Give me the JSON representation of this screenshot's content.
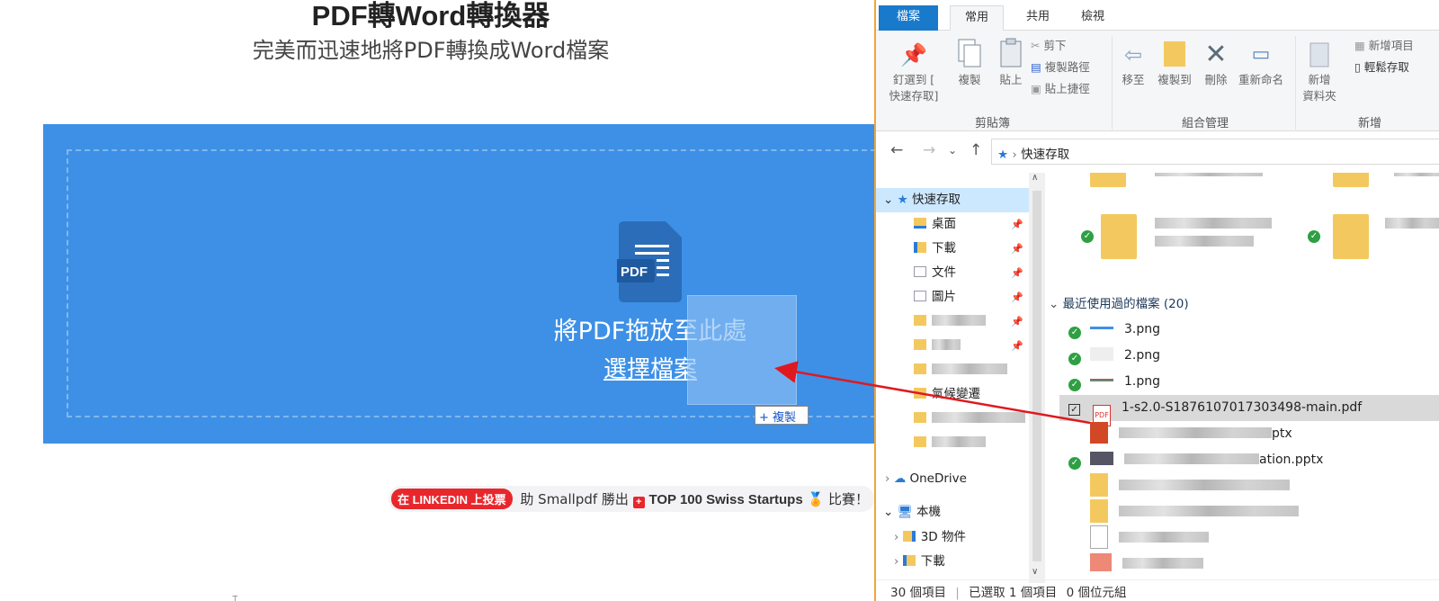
{
  "page": {
    "title": "PDF轉Word轉換器",
    "subtitle": "完美而迅速地將PDF轉換成Word檔案"
  },
  "dropzone": {
    "icon_label": "PDF",
    "drop_text": "將PDF拖放至此處",
    "choose_file": "選擇檔案",
    "copy_tip": "+ 複製",
    "bg": "#3d90e6"
  },
  "banner": {
    "vote": "在 LINKEDIN 上投票",
    "text1": "助 Smallpdf 勝出",
    "highlight": "TOP 100 Swiss Startups",
    "text2": "比賽！"
  },
  "explorer": {
    "tabs": {
      "file": "檔案",
      "home": "常用",
      "share": "共用",
      "view": "檢視"
    },
    "ribbon": {
      "pin": "釘選到 [\n快速存取]",
      "copy": "複製",
      "paste": "貼上",
      "cut": "剪下",
      "copy_path": "複製路徑",
      "paste_shortcut": "貼上捷徑",
      "clipboard": "剪貼簿",
      "move_to": "移至",
      "copy_to": "複製到",
      "delete": "刪除",
      "rename": "重新命名",
      "organize": "組合管理",
      "new_folder": "新增\n資料夾",
      "new_item": "新增項目",
      "easy_access": "輕鬆存取",
      "new": "新增"
    },
    "address": {
      "path": "快速存取"
    },
    "nav": [
      {
        "label": "快速存取",
        "sel": true,
        "pin": false,
        "level": 0
      },
      {
        "label": "桌面",
        "pin": true,
        "level": 1
      },
      {
        "label": "下載",
        "pin": true,
        "level": 1
      },
      {
        "label": "文件",
        "pin": true,
        "level": 1
      },
      {
        "label": "圖片",
        "pin": true,
        "level": 1
      },
      {
        "label": "",
        "pin": true,
        "level": 1
      },
      {
        "label": "",
        "pin": true,
        "level": 1
      },
      {
        "label": "",
        "pin": false,
        "level": 1
      },
      {
        "label": "氣候變遷",
        "pin": false,
        "level": 1
      },
      {
        "label": "",
        "pin": false,
        "level": 1
      },
      {
        "label": "",
        "pin": false,
        "level": 1
      },
      {
        "label": "OneDrive",
        "pin": false,
        "level": 0
      },
      {
        "label": "本機",
        "pin": false,
        "level": 0
      },
      {
        "label": "3D 物件",
        "pin": false,
        "level": 1
      },
      {
        "label": "下載",
        "pin": false,
        "level": 1
      }
    ],
    "recent_header": "最近使用過的檔案 (20)",
    "files": [
      {
        "name": "3.png",
        "check": true
      },
      {
        "name": "2.png",
        "check": true
      },
      {
        "name": "1.png",
        "check": true
      },
      {
        "name": "1-s2.0-S1876107017303498-main.pdf",
        "check": false,
        "selected": true
      },
      {
        "name": "ptx",
        "check": false
      },
      {
        "name": "ation.pptx",
        "check": true
      },
      {
        "name": "",
        "check": false
      },
      {
        "name": "",
        "check": false
      },
      {
        "name": "",
        "check": false
      },
      {
        "name": "",
        "check": false
      }
    ],
    "status": {
      "count": "30 個項目",
      "selected": "已選取 1 個項目",
      "size": "0 個位元組"
    }
  }
}
